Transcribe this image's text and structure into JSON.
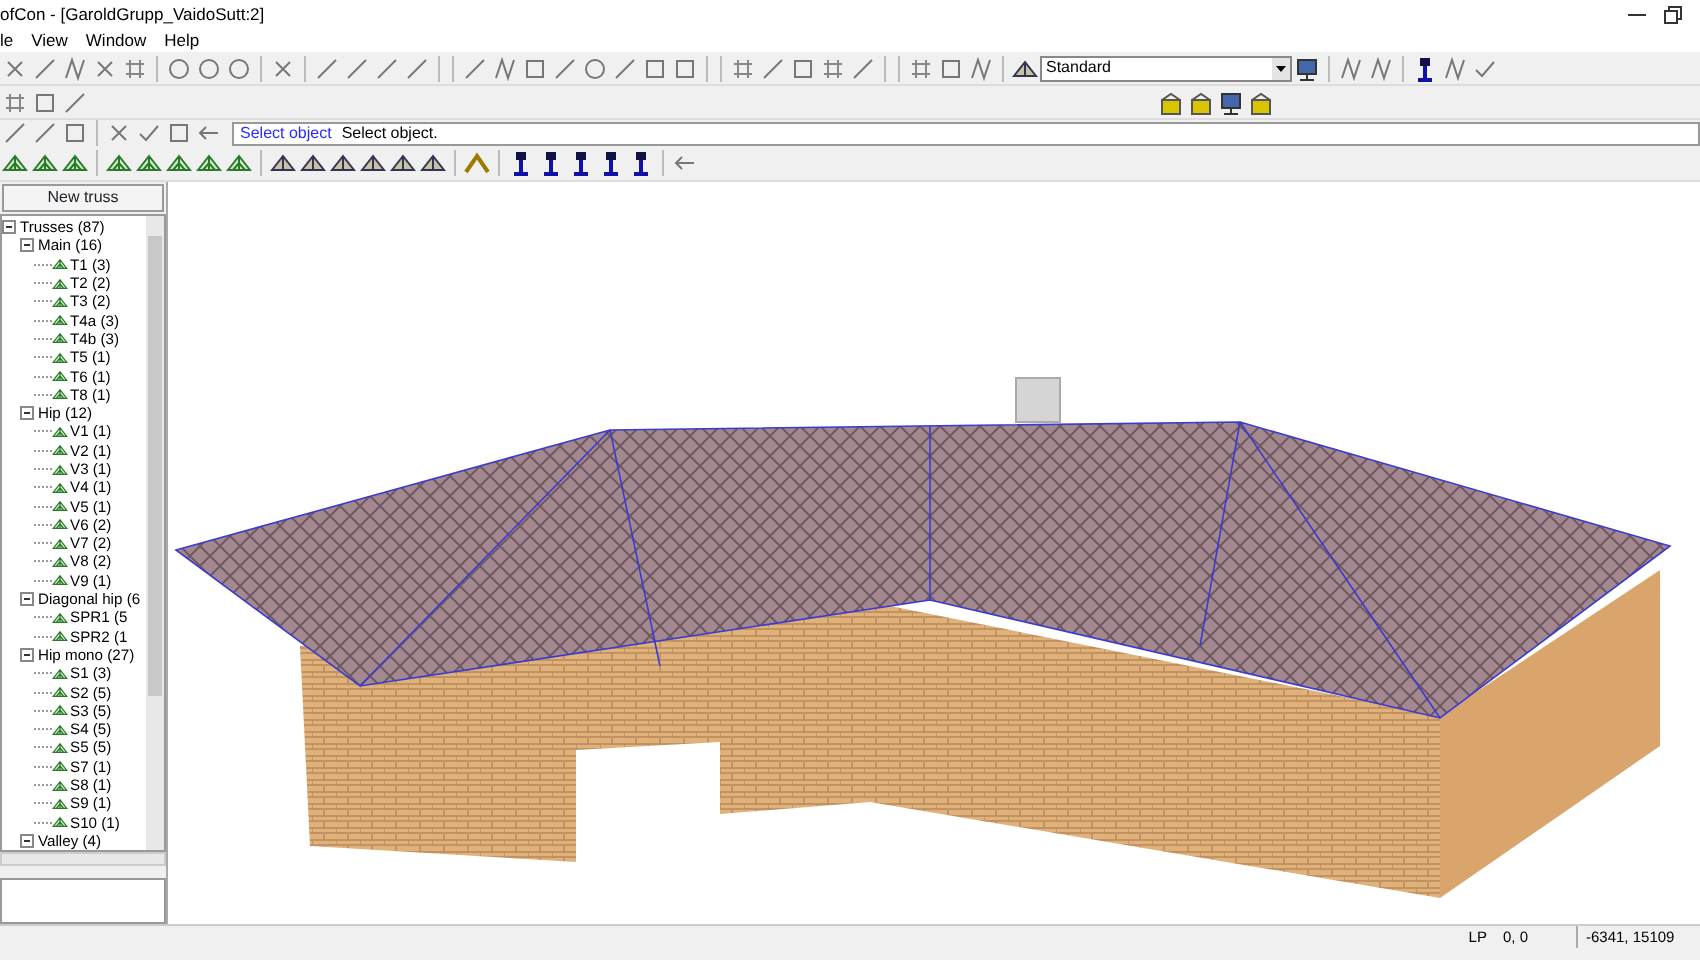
{
  "window": {
    "title": "ofCon - [GaroldGrupp_VaidoSutt:2]"
  },
  "menu": [
    {
      "label": "le"
    },
    {
      "label": "View"
    },
    {
      "label": "Window"
    },
    {
      "label": "Help"
    }
  ],
  "style_select": {
    "value": "Standard"
  },
  "command_line": {
    "prompt": "Select object",
    "message": "Select object."
  },
  "sidebar": {
    "button": "New truss",
    "tree": [
      {
        "label": "Trusses (87)",
        "expanded": true,
        "children": [
          {
            "label": "Main (16)",
            "expanded": true,
            "children": [
              {
                "label": "T1 (3)"
              },
              {
                "label": "T2 (2)"
              },
              {
                "label": "T3 (2)"
              },
              {
                "label": "T4a (3)"
              },
              {
                "label": "T4b (3)"
              },
              {
                "label": "T5 (1)"
              },
              {
                "label": "T6 (1)"
              },
              {
                "label": "T8 (1)"
              }
            ]
          },
          {
            "label": "Hip (12)",
            "expanded": true,
            "children": [
              {
                "label": "V1 (1)"
              },
              {
                "label": "V2 (1)"
              },
              {
                "label": "V3 (1)"
              },
              {
                "label": "V4 (1)"
              },
              {
                "label": "V5 (1)"
              },
              {
                "label": "V6 (2)"
              },
              {
                "label": "V7 (2)"
              },
              {
                "label": "V8 (2)"
              },
              {
                "label": "V9 (1)"
              }
            ]
          },
          {
            "label": "Diagonal hip (6",
            "expanded": true,
            "children": [
              {
                "label": "SPR1 (5"
              },
              {
                "label": "SPR2 (1"
              }
            ]
          },
          {
            "label": "Hip mono (27)",
            "expanded": true,
            "children": [
              {
                "label": "S1 (3)"
              },
              {
                "label": "S2 (5)"
              },
              {
                "label": "S3 (5)"
              },
              {
                "label": "S4 (5)"
              },
              {
                "label": "S5 (5)"
              },
              {
                "label": "S7 (1)"
              },
              {
                "label": "S8 (1)"
              },
              {
                "label": "S9 (1)"
              },
              {
                "label": "S10 (1)"
              }
            ]
          },
          {
            "label": "Valley (4)",
            "expanded": true
          }
        ]
      }
    ]
  },
  "status_bar": {
    "mode": "LP",
    "offset": "0, 0",
    "coordinates": "-6341, 15109"
  }
}
